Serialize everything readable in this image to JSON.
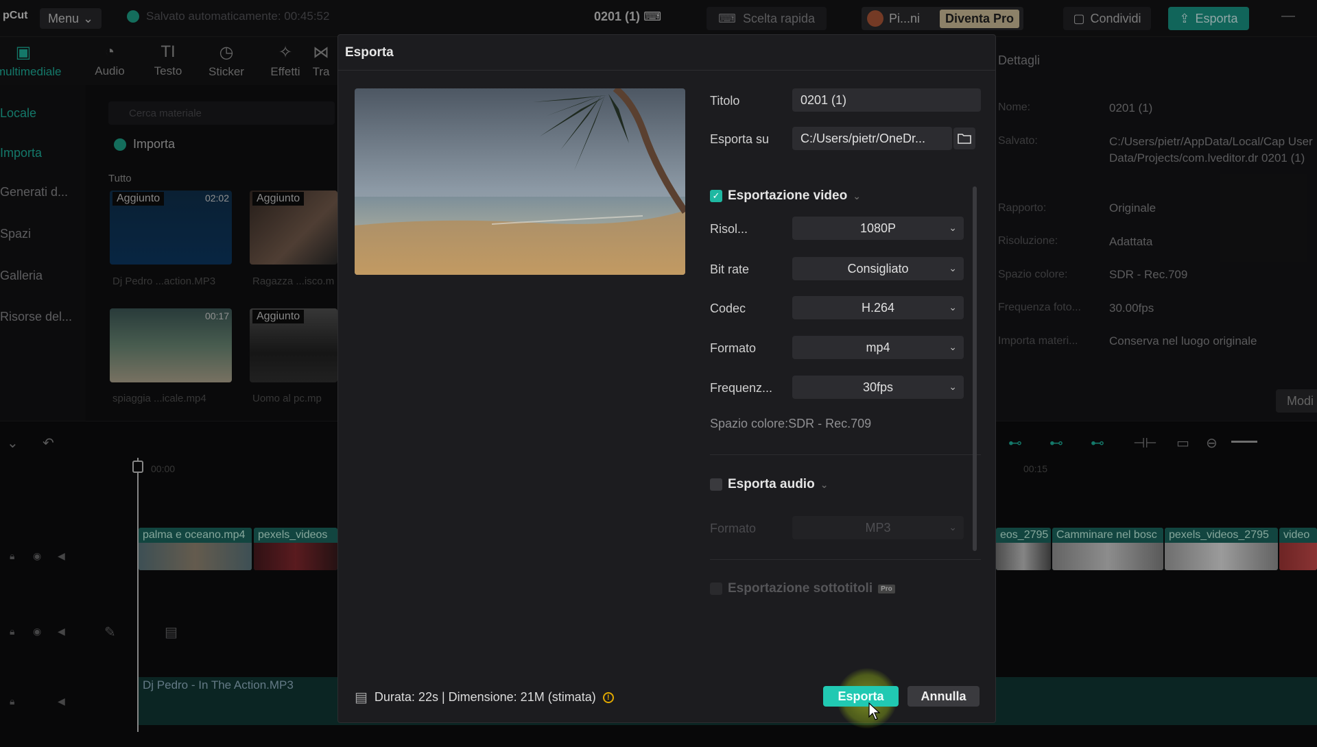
{
  "app": {
    "logo": "pCut",
    "menu_label": "Menu",
    "autosave": "Salvato automaticamente: 00:45:52",
    "project_name": "0201 (1)",
    "quick_label": "Scelta rapida",
    "user_label": "Pi...ni",
    "pro_label": "Diventa Pro",
    "share_label": "Condividi",
    "export_label": "Esporta"
  },
  "tools": [
    {
      "label": "multimediale",
      "icon": "media-icon"
    },
    {
      "label": "Audio",
      "icon": "audio-icon"
    },
    {
      "label": "Testo",
      "icon": "text-icon"
    },
    {
      "label": "Sticker",
      "icon": "sticker-icon"
    },
    {
      "label": "Effetti",
      "icon": "effects-icon"
    },
    {
      "label": "Tra",
      "icon": "transition-icon"
    }
  ],
  "sidebar": {
    "items": [
      "Locale",
      "Importa",
      "Generati d...",
      "Spazi",
      "Galleria",
      "Risorse del..."
    ]
  },
  "media": {
    "search_placeholder": "Cerca materiale",
    "import_label": "Importa",
    "filter_label": "Tutto",
    "items": [
      {
        "tag": "Aggiunto",
        "duration": "02:02",
        "caption": "Dj Pedro ...action.MP3"
      },
      {
        "tag": "Aggiunto",
        "duration": "",
        "caption": "Ragazza ...isco.m"
      },
      {
        "tag": "",
        "duration": "00:17",
        "caption": "spiaggia ...icale.mp4"
      },
      {
        "tag": "Aggiunto",
        "duration": "",
        "caption": "Uomo al pc.mp"
      }
    ]
  },
  "details": {
    "title": "Dettagli",
    "rows": [
      {
        "key": "Nome:",
        "value": "0201 (1)"
      },
      {
        "key": "Salvato:",
        "value": "C:/Users/pietr/AppData/Local/Cap User Data/Projects/com.lveditor.dr 0201 (1)"
      },
      {
        "key": "Rapporto:",
        "value": "Originale"
      },
      {
        "key": "Risoluzione:",
        "value": "Adattata"
      },
      {
        "key": "Spazio colore:",
        "value": "SDR - Rec.709"
      },
      {
        "key": "Frequenza foto...",
        "value": "30.00fps"
      },
      {
        "key": "Importa materi...",
        "value": "Conserva nel luogo originale"
      }
    ],
    "modify_label": "Modi"
  },
  "timeline": {
    "time_start": "00:00",
    "time_mark": "00:15",
    "clips": [
      "palma e oceano.mp4",
      "pexels_videos",
      "eos_2795",
      "Camminare nel bosc",
      "pexels_videos_2795",
      "video"
    ],
    "audio_clip": "Dj Pedro - In The Action.MP3"
  },
  "dialog": {
    "title": "Esporta",
    "title_label": "Titolo",
    "title_value": "0201 (1)",
    "export_to_label": "Esporta su",
    "export_to_value": "C:/Users/pietr/OneDr...",
    "video_section": "Esportazione video",
    "video_enabled": true,
    "resolution_label": "Risol...",
    "resolution_value": "1080P",
    "bitrate_label": "Bit rate",
    "bitrate_value": "Consigliato",
    "codec_label": "Codec",
    "codec_value": "H.264",
    "format_label": "Formato",
    "format_value": "mp4",
    "fps_label": "Frequenz...",
    "fps_value": "30fps",
    "colorspace": "Spazio colore:SDR - Rec.709",
    "audio_section": "Esporta audio",
    "audio_enabled": false,
    "audio_format_label": "Formato",
    "audio_format_value": "MP3",
    "subtitle_section": "Esportazione sottotitoli",
    "subtitle_badge": "Pro",
    "footer_info": "Durata: 22s | Dimensione: 21M (stimata)",
    "export_button": "Esporta",
    "cancel_button": "Annulla"
  },
  "colors": {
    "accent": "#1fb8a2",
    "export_button": "#21c9b2",
    "click_highlight": "#c8e628"
  }
}
